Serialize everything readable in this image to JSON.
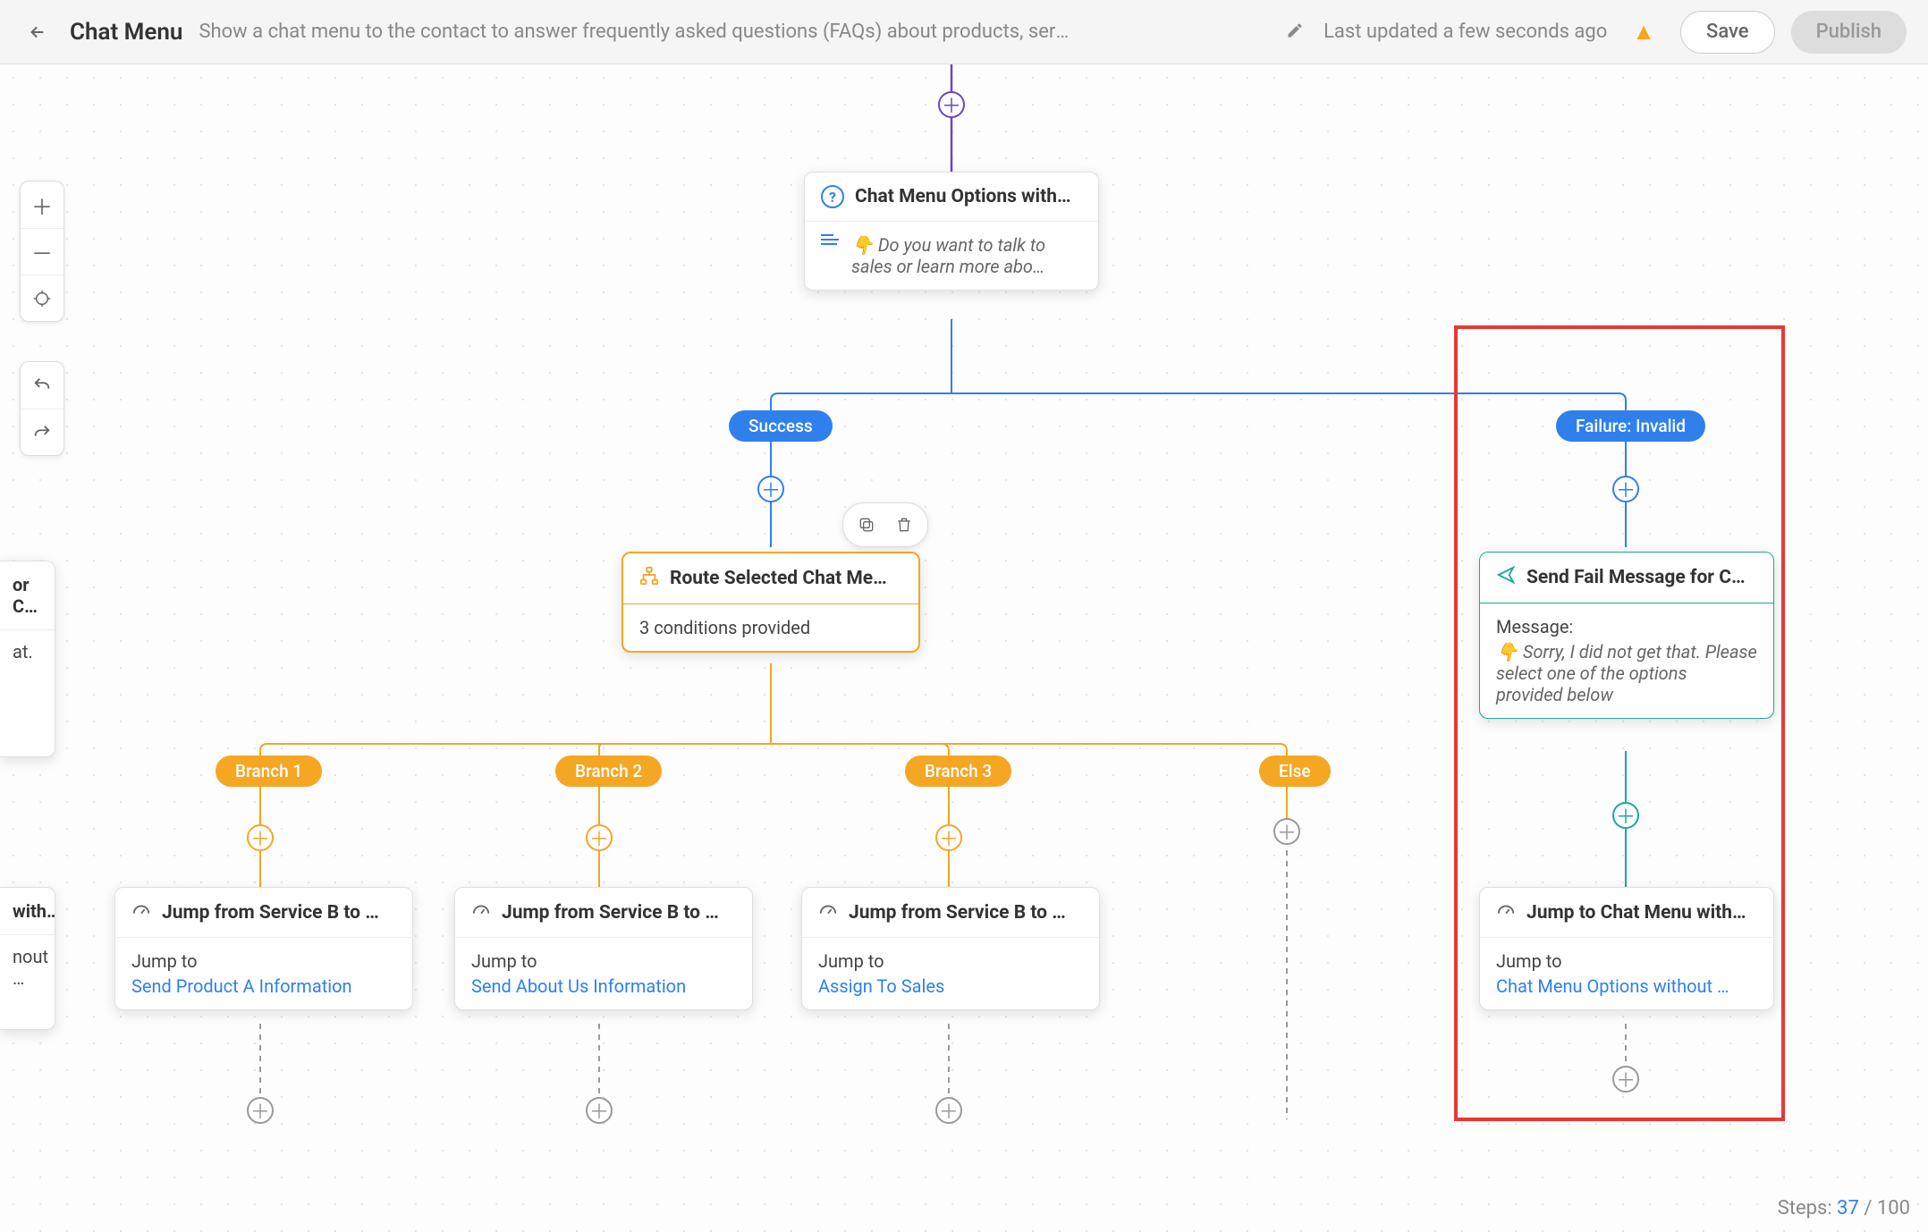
{
  "header": {
    "title": "Chat Menu",
    "description": "Show a chat menu to the contact to answer frequently asked questions (FAQs) about products, servic…",
    "last_updated": "Last updated a few seconds ago",
    "save_label": "Save",
    "publish_label": "Publish"
  },
  "nodes": {
    "chat_menu_options": {
      "title": "Chat Menu Options with…",
      "body": "👇 Do you want to talk to sales or learn more abo…"
    },
    "route_selected": {
      "title": "Route Selected Chat Me…",
      "body": "3 conditions provided"
    },
    "send_fail": {
      "title": "Send Fail Message for C…",
      "label": "Message:",
      "body": "👇 Sorry, I did not get that. Please select one of the options provided below"
    },
    "jump_1": {
      "title": "Jump from Service B to …",
      "label": "Jump to",
      "target": "Send Product A Information"
    },
    "jump_2": {
      "title": "Jump from Service B to …",
      "label": "Jump to",
      "target": "Send About Us Information"
    },
    "jump_3": {
      "title": "Jump from Service B to …",
      "label": "Jump to",
      "target": "Assign To Sales"
    },
    "jump_fail": {
      "title": "Jump to Chat Menu with…",
      "label": "Jump to",
      "target": "Chat Menu Options without …"
    }
  },
  "pills": {
    "success": "Success",
    "failure": "Failure: Invalid",
    "branch1": "Branch 1",
    "branch2": "Branch 2",
    "branch3": "Branch 3",
    "else": "Else"
  },
  "partial": {
    "a_title": "or C…",
    "a_body": "at.",
    "b_title": "with…",
    "b_link": "nout …"
  },
  "footer": {
    "steps_label": "Steps:",
    "steps_current": "37",
    "steps_max": "100"
  }
}
